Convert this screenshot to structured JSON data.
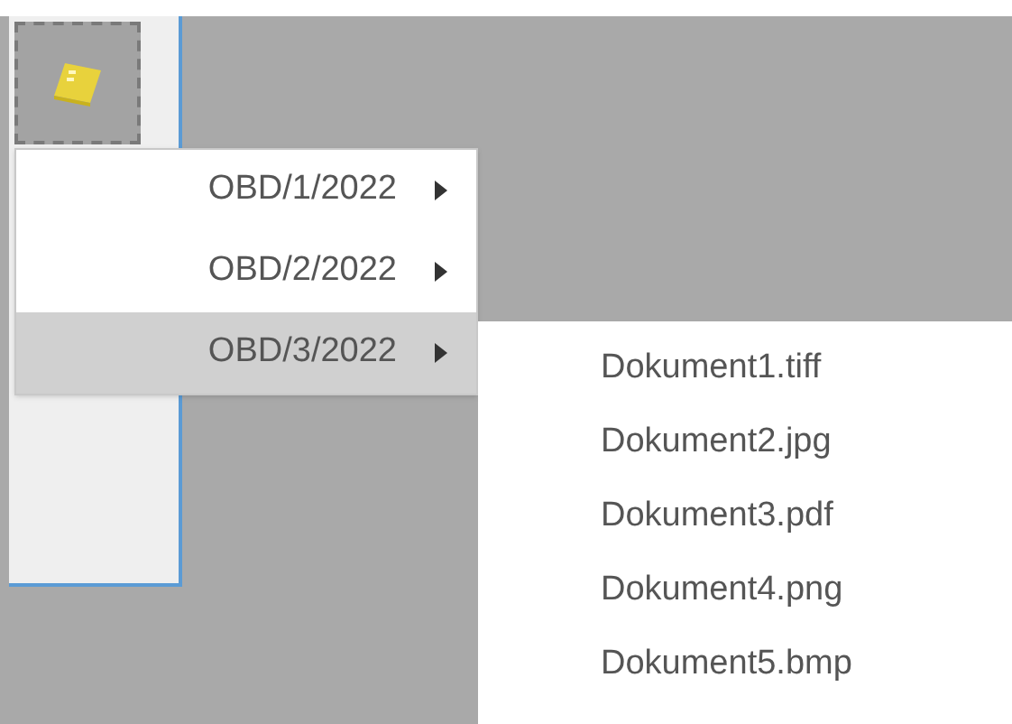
{
  "menu": {
    "items": [
      {
        "label": "OBD/1/2022",
        "selected": false
      },
      {
        "label": "OBD/2/2022",
        "selected": false
      },
      {
        "label": "OBD/3/2022",
        "selected": true
      }
    ]
  },
  "submenu": {
    "items": [
      {
        "label": "Dokument1.tiff"
      },
      {
        "label": "Dokument2.jpg"
      },
      {
        "label": "Dokument3.pdf"
      },
      {
        "label": "Dokument4.png"
      },
      {
        "label": "Dokument5.bmp"
      }
    ]
  }
}
